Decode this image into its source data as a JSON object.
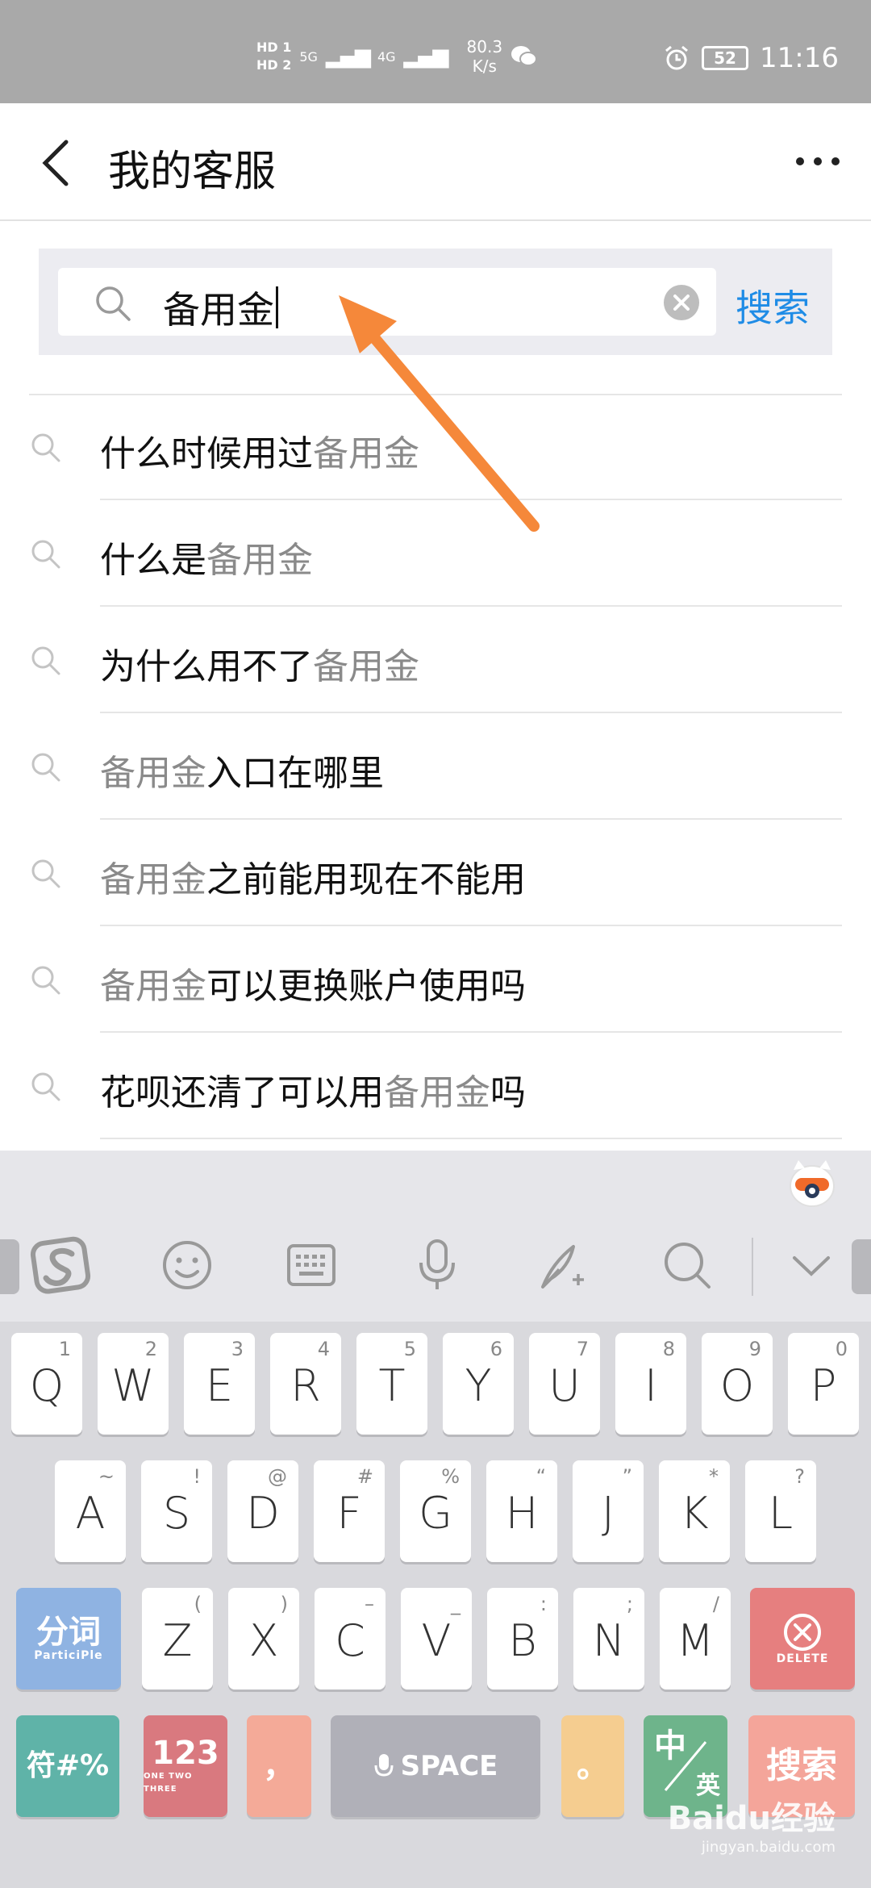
{
  "status_bar": {
    "hd1": "HD 1",
    "hd2": "HD 2",
    "net1": "5G",
    "net2": "4G",
    "speed_value": "80.3",
    "speed_unit": "K/s",
    "battery": "52",
    "time": "11:16"
  },
  "header": {
    "title": "我的客服"
  },
  "search": {
    "query": "备用金",
    "button_label": "搜索"
  },
  "suggestions": [
    {
      "before": "什么时候用过",
      "highlight": "备用金",
      "after": ""
    },
    {
      "before": "什么是",
      "highlight": "备用金",
      "after": ""
    },
    {
      "before": "为什么用不了",
      "highlight": "备用金",
      "after": ""
    },
    {
      "before": "",
      "highlight": "备用金",
      "after": "入口在哪里"
    },
    {
      "before": "",
      "highlight": "备用金",
      "after": "之前能用现在不能用"
    },
    {
      "before": "",
      "highlight": "备用金",
      "after": "可以更换账户使用吗"
    },
    {
      "before": "花呗还清了可以用",
      "highlight": "备用金",
      "after": "吗"
    }
  ],
  "keyboard": {
    "row1": [
      {
        "main": "Q",
        "sub": "1"
      },
      {
        "main": "W",
        "sub": "2"
      },
      {
        "main": "E",
        "sub": "3"
      },
      {
        "main": "R",
        "sub": "4"
      },
      {
        "main": "T",
        "sub": "5"
      },
      {
        "main": "Y",
        "sub": "6"
      },
      {
        "main": "U",
        "sub": "7"
      },
      {
        "main": "I",
        "sub": "8"
      },
      {
        "main": "O",
        "sub": "9"
      },
      {
        "main": "P",
        "sub": "0"
      }
    ],
    "row2": [
      {
        "main": "A",
        "sub": "~"
      },
      {
        "main": "S",
        "sub": "!"
      },
      {
        "main": "D",
        "sub": "@"
      },
      {
        "main": "F",
        "sub": "#"
      },
      {
        "main": "G",
        "sub": "%"
      },
      {
        "main": "H",
        "sub": "“"
      },
      {
        "main": "J",
        "sub": "”"
      },
      {
        "main": "K",
        "sub": "*"
      },
      {
        "main": "L",
        "sub": "?"
      }
    ],
    "row3": [
      {
        "main": "Z",
        "sub": "("
      },
      {
        "main": "X",
        "sub": ")"
      },
      {
        "main": "C",
        "sub": "–"
      },
      {
        "main": "V",
        "sub": "_"
      },
      {
        "main": "B",
        "sub": ":"
      },
      {
        "main": "N",
        "sub": ";"
      },
      {
        "main": "M",
        "sub": "/"
      }
    ],
    "participle_big": "分词",
    "participle_small": "ParticiPle",
    "delete_label": "DELETE",
    "symbols_label": "符#%",
    "num_big": "123",
    "num_small": "ONE TWO THREE",
    "comma": "，",
    "space_label": "SPACE",
    "period": "。",
    "lang_zh": "中",
    "lang_en": "英",
    "enter_label": "搜索",
    "colors": {
      "participle": "#8fb3e2",
      "delete": "#e67f7f",
      "symbols": "#5fb3a8",
      "num": "#d9797f",
      "comma": "#f4aa98",
      "space": "#b0b0b8",
      "period": "#f5cd90",
      "lang": "#6eb48b",
      "enter": "#f4a59a"
    }
  },
  "watermark": {
    "brand": "Baidu经验",
    "url": "jingyan.baidu.com"
  }
}
